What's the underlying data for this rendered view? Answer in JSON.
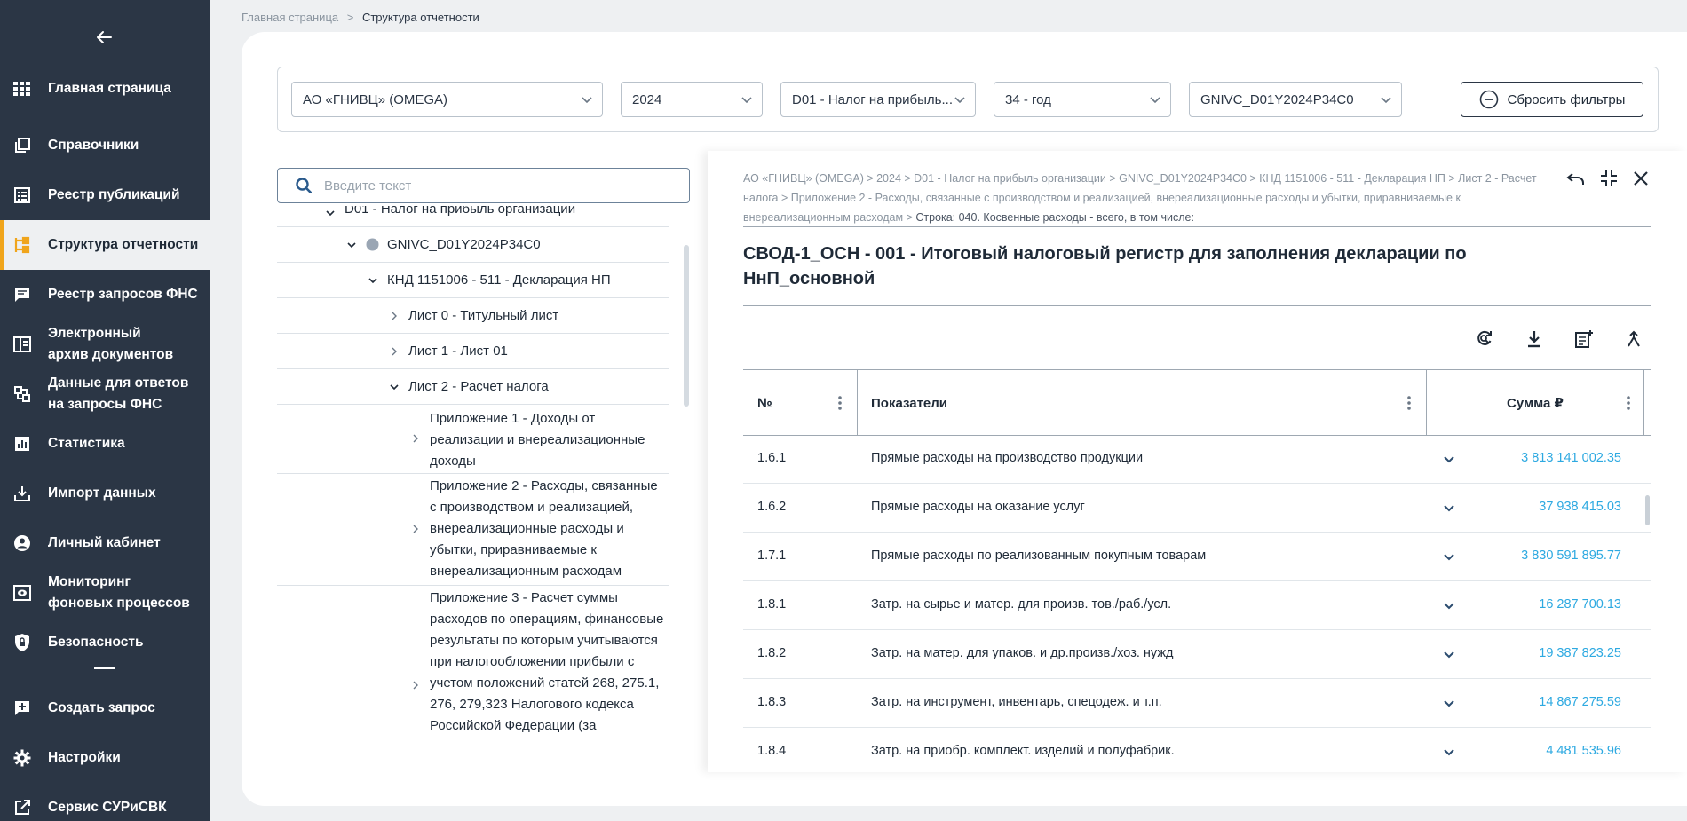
{
  "sidebar": {
    "back_icon": "arrow-left-icon",
    "items": [
      {
        "label": "Главная страница",
        "icon": "grid-icon"
      },
      {
        "label": "Справочники",
        "icon": "books-icon"
      },
      {
        "label": "Реестр публикаций",
        "icon": "list-icon"
      },
      {
        "label": "Структура отчетности",
        "icon": "tree-structure-icon"
      },
      {
        "label": "Реестр запросов ФНС",
        "icon": "chat-icon"
      },
      {
        "label": "Электронный архив документов",
        "icon": "archive-icon"
      },
      {
        "label": "Данные для ответов на запросы ФНС",
        "icon": "data-share-icon"
      },
      {
        "label": "Статистика",
        "icon": "chart-icon"
      },
      {
        "label": "Импорт данных",
        "icon": "import-icon"
      },
      {
        "label": "Личный кабинет",
        "icon": "user-icon"
      },
      {
        "label": "Мониторинг фоновых процессов",
        "icon": "monitor-icon"
      },
      {
        "label": "Безопасность",
        "icon": "shield-icon"
      },
      {
        "label": "Создать запрос",
        "icon": "add-box-icon"
      },
      {
        "label": "Настройки",
        "icon": "gear-icon"
      },
      {
        "label": "Сервис СУРиСВК",
        "icon": "external-link-icon"
      }
    ],
    "active_color": "#f0a51c"
  },
  "breadcrumb": {
    "home": "Главная страница",
    "separator": ">",
    "current": "Структура отчетности"
  },
  "filters": {
    "organization": "АО «ГНИВЦ» (OMEGA)",
    "year": "2024",
    "tax": "D01 - Налог на прибыль...",
    "period": "34 - год",
    "register": "GNIVC_D01Y2024P34C0",
    "reset_label": "Сбросить фильтры"
  },
  "search": {
    "placeholder": "Введите текст"
  },
  "tree": {
    "rows": [
      {
        "label": "D01 - Налог на прибыль организации"
      },
      {
        "label": "GNIVC_D01Y2024P34C0"
      },
      {
        "label": "КНД 1151006 - 511 - Декларация НП"
      },
      {
        "label": "Лист 0 - Титульный лист"
      },
      {
        "label": "Лист 1 - Лист 01"
      },
      {
        "label": "Лист 2 - Расчет налога"
      },
      {
        "lines": [
          "Приложение 1 - Доходы от",
          "реализации и внереализационные",
          "доходы"
        ]
      },
      {
        "lines": [
          "Приложение 2 - Расходы, связанные",
          "с производством и реализацией,",
          "внереализационные расходы и",
          "убытки, приравниваемые к",
          "внереализационным расходам"
        ]
      },
      {
        "lines": [
          "Приложение 3 - Расчет суммы",
          "расходов по операциям, финансовые",
          "результаты по которым учитываются",
          "при налогообложении прибыли с",
          "учетом положений статей 268, 275.1,",
          "276, 279,323 Налогового кодекса",
          "Российской Федерации (за"
        ]
      }
    ]
  },
  "detail": {
    "crumbs": [
      "АО «ГНИВЦ» (OMEGA) > 2024 > D01 - Налог на прибыль организации > GNIVC_D01Y2024P34C0 > КНД 1151006 - 511 - Декларация НП > Лист 2 - Расчет",
      "налога > Приложение 2 - Расходы, связанные с производством и реализацией, внереализационные расходы и убытки, приравниваемые к",
      "внереализационным расходам >"
    ],
    "crumb_last": "Строка: 040. Косвенные расходы - всего, в том числе:",
    "title_lines": [
      "СВОД-1_ОСН - 001 - Итоговый налоговый регистр для заполнения декларации по",
      "НнП_основной"
    ],
    "table": {
      "headers": {
        "num": "№",
        "indicator": "Показатели",
        "sum": "Сумма ₽"
      },
      "rows": [
        {
          "num": "1.6.1",
          "indicator": "Прямые расходы на производство продукции",
          "sum": "3 813 141 002.35"
        },
        {
          "num": "1.6.2",
          "indicator": "Прямые расходы на оказание услуг",
          "sum": "37 938 415.03"
        },
        {
          "num": "1.7.1",
          "indicator": "Прямые расходы по реализованным покупным товарам",
          "sum": "3 830 591 895.77"
        },
        {
          "num": "1.8.1",
          "indicator": "Затр. на сырье и матер. для произв. тов./раб./усл.",
          "sum": "16 287 700.13"
        },
        {
          "num": "1.8.2",
          "indicator": "Затр. на матер. для упаков. и др.произв./хоз. нужд",
          "sum": "19 387 823.25"
        },
        {
          "num": "1.8.3",
          "indicator": "Затр. на инструмент, инвентарь, спецодеж. и т.п.",
          "sum": "14 867 275.59"
        },
        {
          "num": "1.8.4",
          "indicator": "Затр. на приобр. комплект. изделий и полуфабрик.",
          "sum": "4 481 535.96"
        }
      ]
    },
    "link_color": "#2da9e1"
  }
}
